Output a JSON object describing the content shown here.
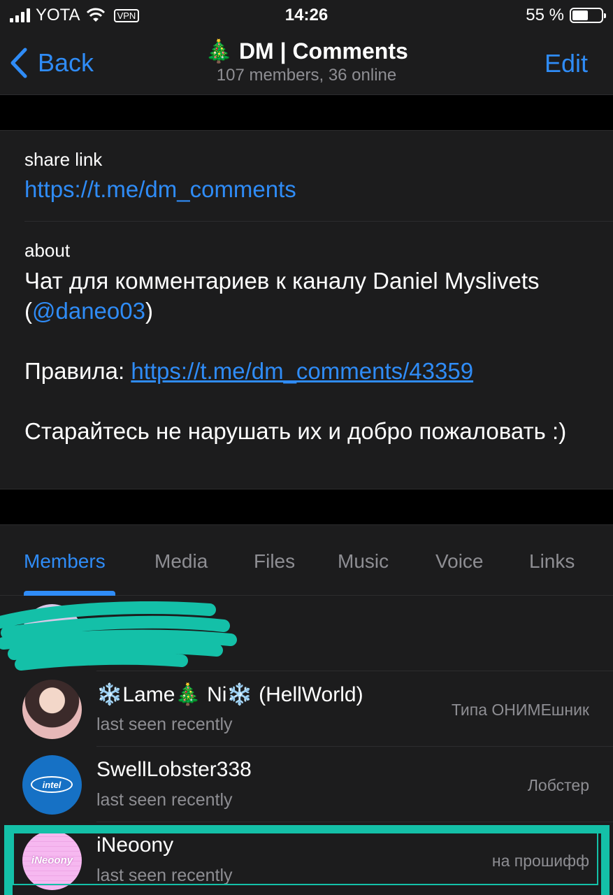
{
  "status_bar": {
    "carrier": "YOTA",
    "vpn": "VPN",
    "time": "14:26",
    "battery_percent": "55 %",
    "battery_level": 0.55
  },
  "nav": {
    "back_label": "Back",
    "title_emoji": "🎄",
    "title": "DM | Comments",
    "subtitle": "107 members, 36 online",
    "edit_label": "Edit"
  },
  "info": {
    "share_label": "share link",
    "share_url": "https://t.me/dm_comments",
    "about_label": "about",
    "about_line1": "Чат для комментариев к каналу Daniel Myslivets",
    "about_paren_open": "(",
    "about_handle": "@daneo03",
    "about_paren_close": ")",
    "rules_prefix": "Правила: ",
    "rules_url": "https://t.me/dm_comments/43359",
    "closing_text": "Старайтесь не нарушать их и добро пожаловать :)"
  },
  "tabs": [
    {
      "label": "Members",
      "active": true
    },
    {
      "label": "Media",
      "active": false
    },
    {
      "label": "Files",
      "active": false
    },
    {
      "label": "Music",
      "active": false
    },
    {
      "label": "Voice",
      "active": false
    },
    {
      "label": "Links",
      "active": false
    }
  ],
  "members": [
    {
      "name": "❄️Lame🎄 Ni❄️ (HellWorld)",
      "status": "last seen recently",
      "role": "Типа ОНИМЕшник",
      "avatar": "anime-avatar"
    },
    {
      "name": "SwellLobster338",
      "status": "last seen recently",
      "role": "Лобстер",
      "avatar": "intel-avatar",
      "avatar_text": "intel"
    },
    {
      "name": "iNeoony",
      "status": "last seen recently",
      "role": "на прошифф",
      "avatar": "neo-avatar",
      "avatar_text": "iNeoony"
    }
  ],
  "colors": {
    "accent": "#2f8cf7",
    "background": "#1c1c1d",
    "highlight": "#14c0a8"
  }
}
